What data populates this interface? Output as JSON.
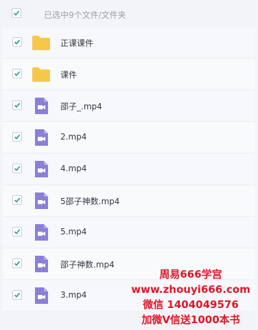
{
  "header": {
    "selection_text": "已选中9个文件/文件夹"
  },
  "files": [
    {
      "name": "正课课件",
      "type": "folder"
    },
    {
      "name": "课件",
      "type": "folder"
    },
    {
      "name": "邵子_.mp4",
      "type": "video"
    },
    {
      "name": "2.mp4",
      "type": "video"
    },
    {
      "name": "4.mp4",
      "type": "video"
    },
    {
      "name": "5邵子神数.mp4",
      "type": "video"
    },
    {
      "name": "5.mp4",
      "type": "video"
    },
    {
      "name": "邵子神数.mp4",
      "type": "video"
    },
    {
      "name": "3.mp4",
      "type": "video"
    }
  ],
  "watermark": {
    "line1": "周易666学宫",
    "line2": "www.zhouyi666.com",
    "line3": "微信 1404049576",
    "line4": "加微V信送1000本书"
  },
  "colors": {
    "checkbox_check": "#2e9ea2",
    "folder": "#f6c84a",
    "video": "#8b7fd8",
    "watermark": "#e0162a"
  }
}
